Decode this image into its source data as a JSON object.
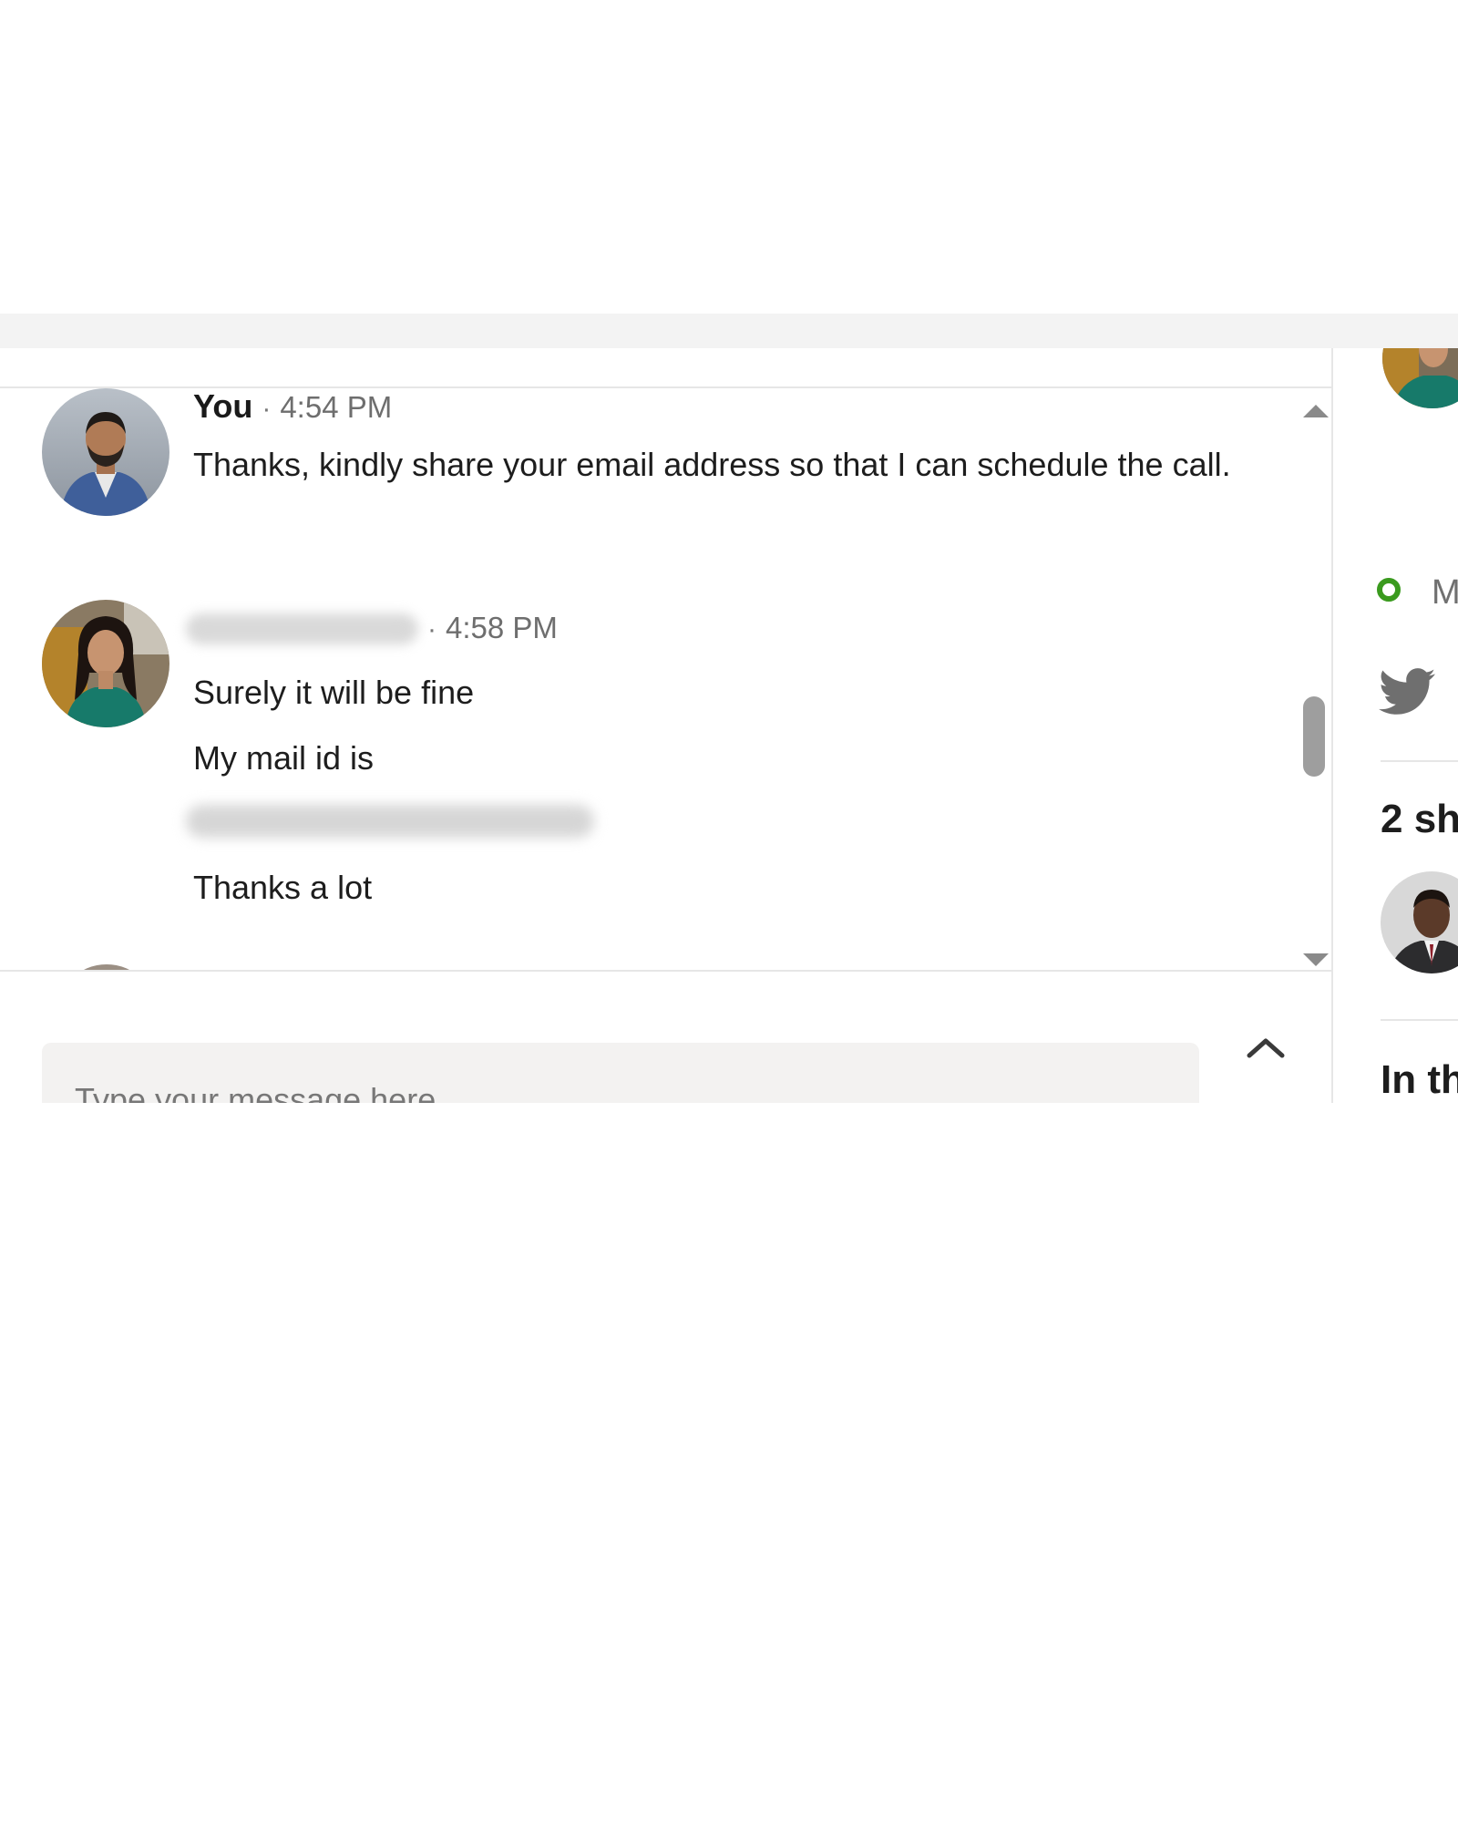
{
  "conversation": {
    "messages": [
      {
        "sender": "You",
        "separator": "·",
        "time": "4:54 PM",
        "lines": [
          "Thanks, kindly share your email address so that I can schedule the call."
        ]
      },
      {
        "separator": "·",
        "time": "4:58 PM",
        "lines": [
          "Surely it will be fine",
          "My mail id is",
          "Thanks a lot"
        ]
      }
    ]
  },
  "composer": {
    "placeholder": "Type your message here"
  },
  "side_panel": {
    "status_label": "M",
    "shared_heading": "2 sh",
    "in_heading": "In th"
  },
  "colors": {
    "status_green": "#3a9a1e",
    "twitter_gray": "#6f6f6f"
  },
  "icons": [
    "chevron-up-icon",
    "scroll-up-arrow-icon",
    "scroll-down-arrow-icon",
    "twitter-icon",
    "status-ring-icon"
  ]
}
